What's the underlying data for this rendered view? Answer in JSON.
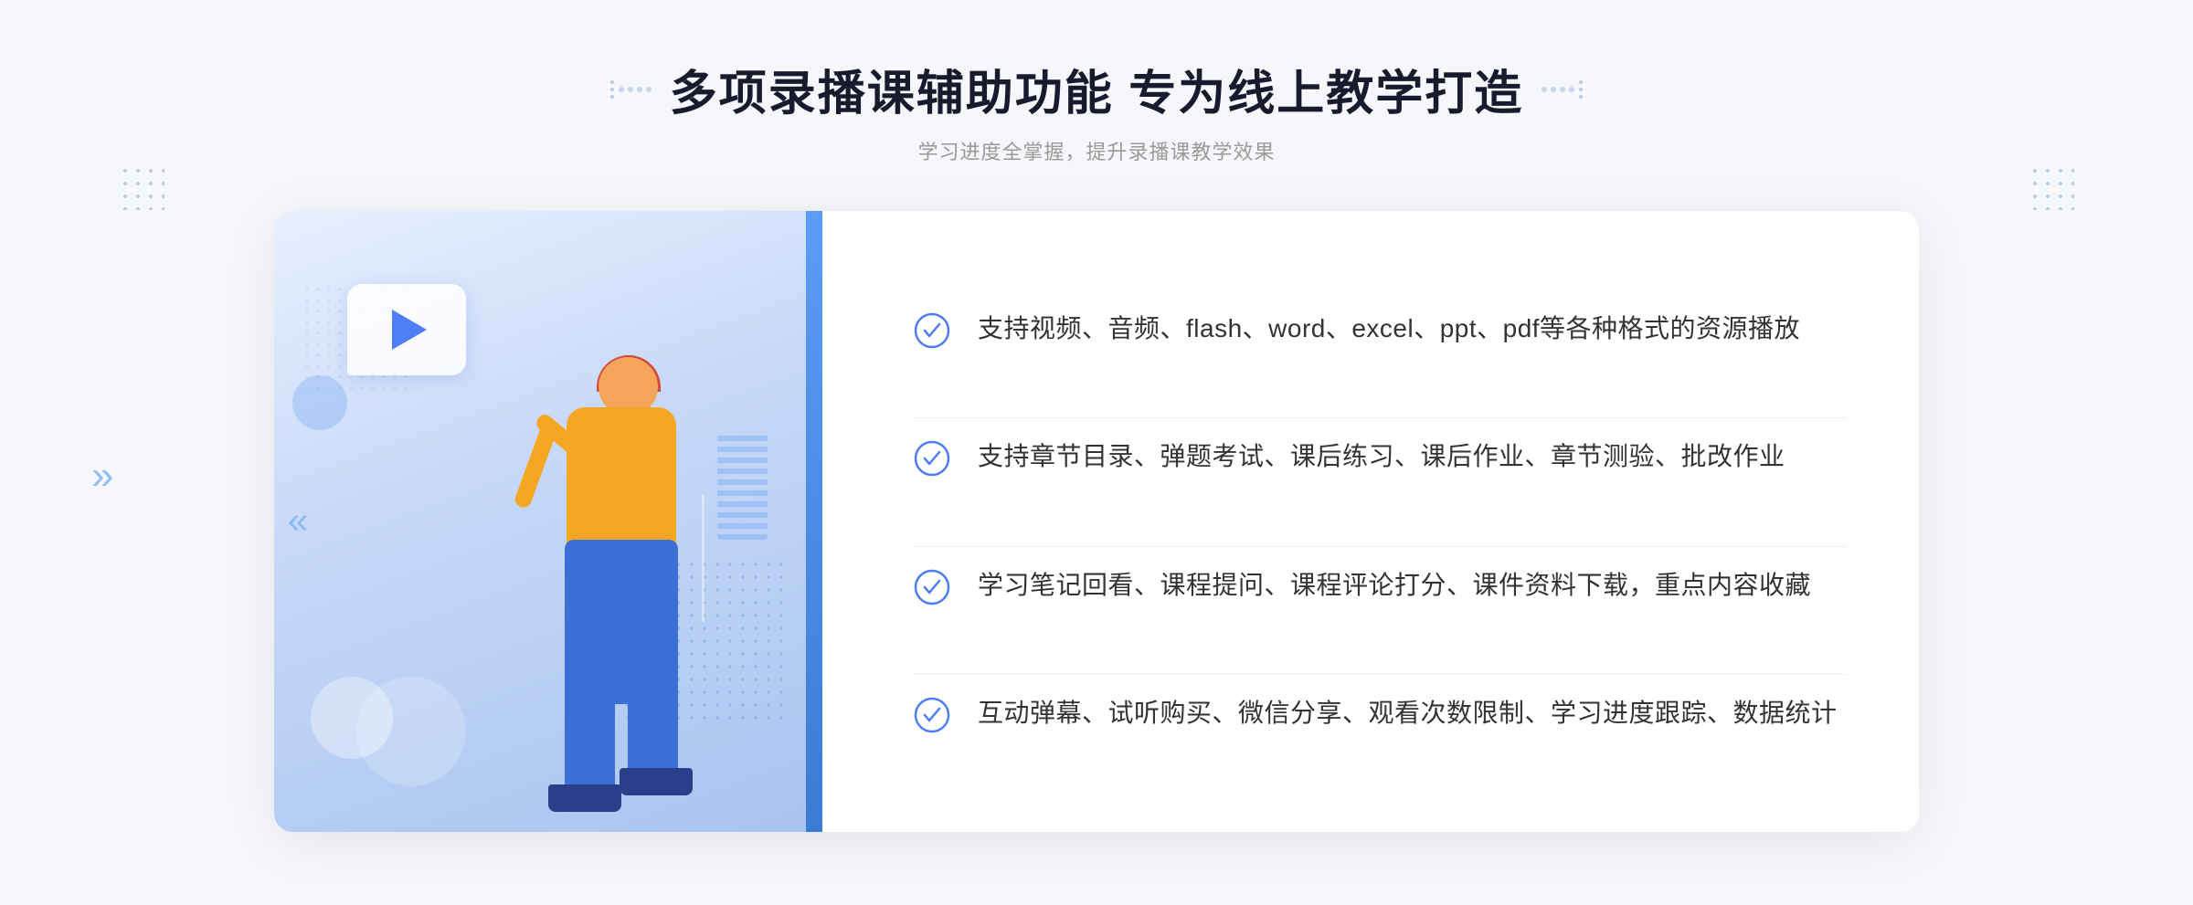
{
  "page": {
    "background_color": "#f5f7fa"
  },
  "header": {
    "title": "多项录播课辅助功能 专为线上教学打造",
    "subtitle": "学习进度全掌握，提升录播课教学效果"
  },
  "features": [
    {
      "id": 1,
      "text": "支持视频、音频、flash、word、excel、ppt、pdf等各种格式的资源播放"
    },
    {
      "id": 2,
      "text": "支持章节目录、弹题考试、课后练习、课后作业、章节测验、批改作业"
    },
    {
      "id": 3,
      "text": "学习笔记回看、课程提问、课程评论打分、课件资料下载，重点内容收藏"
    },
    {
      "id": 4,
      "text": "互动弹幕、试听购买、微信分享、观看次数限制、学习进度跟踪、数据统计"
    }
  ],
  "icons": {
    "check": "check-circle-icon",
    "play": "play-icon",
    "chevron": "chevron-left-icon"
  },
  "colors": {
    "primary_blue": "#4d7ef7",
    "light_blue": "#7ab0f5",
    "accent_blue": "#3a6fd8",
    "text_dark": "#333333",
    "text_light": "#999999",
    "border": "#f0f0f0",
    "bg": "#f5f7fa"
  }
}
